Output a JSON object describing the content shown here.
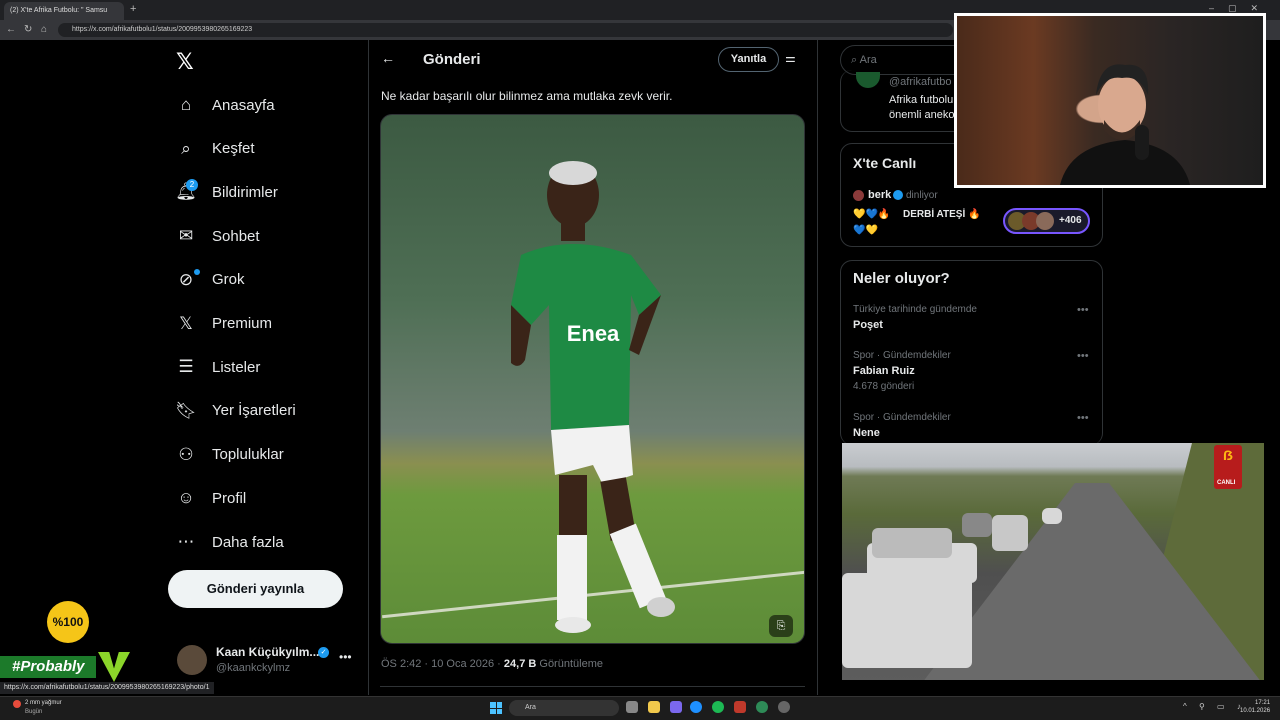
{
  "browser": {
    "tab_title": "(2) X'te Afrika Futbolu: \" Samsu",
    "url": "https://x.com/afrikafutbolu1/status/2009953980265169223",
    "status_url": "https://x.com/afrikafutbolu1/status/2009953980265169223/photo/1"
  },
  "sidebar": {
    "items": [
      {
        "label": "Anasayfa",
        "icon": "home-icon"
      },
      {
        "label": "Keşfet",
        "icon": "search-icon"
      },
      {
        "label": "Bildirimler",
        "icon": "bell-icon"
      },
      {
        "label": "Sohbet",
        "icon": "mail-icon"
      },
      {
        "label": "Grok",
        "icon": "grok-icon"
      },
      {
        "label": "Premium",
        "icon": "x-premium-icon"
      },
      {
        "label": "Listeler",
        "icon": "list-icon"
      },
      {
        "label": "Yer İşaretleri",
        "icon": "bookmark-icon"
      },
      {
        "label": "Topluluklar",
        "icon": "communities-icon"
      },
      {
        "label": "Profil",
        "icon": "profile-icon"
      },
      {
        "label": "Daha fazla",
        "icon": "more-icon"
      }
    ],
    "notification_count": "2",
    "post_button": "Gönderi yayınla",
    "account": {
      "name": "Kaan Küçükyılm...",
      "handle": "@kaankckylmz"
    }
  },
  "main": {
    "title": "Gönderi",
    "reply_button": "Yanıtla",
    "post_text": "Ne kadar başarılı olur bilinmez ama mutlaka zevk verir.",
    "jersey_sponsor": "Enea",
    "meta_time": "ÖS 2:42 · 10 Oca 2026 · ",
    "meta_views": "24,7 B",
    "meta_views_label": " Görüntüleme"
  },
  "right": {
    "search_placeholder": "Ara",
    "card1": {
      "handle": "@afrikafutbo",
      "line1": "Afrika futbolu",
      "line2": "önemli aneko"
    },
    "live": {
      "title": "X'te Canlı",
      "user": "berk",
      "status": "dinliyor",
      "emoji_prefix": "💛💙🔥",
      "space_title": "DERBİ ATEŞİ",
      "emoji_suffix": "🔥",
      "emoji_line2": "💙💛",
      "listener_count": "+406"
    },
    "trends_title": "Neler oluyor?",
    "trends": [
      {
        "context": "Türkiye tarihinde gündemde",
        "name": "Poşet",
        "count": ""
      },
      {
        "context": "Spor · Gündemdekiler",
        "name": "Fabian Ruiz",
        "count": "4.678 gönderi"
      },
      {
        "context": "Spor · Gündemdekiler",
        "name": "Nene",
        "count": ""
      }
    ]
  },
  "overlays": {
    "x100": "%100",
    "probably": "#Probably",
    "gs_live": "CANLI"
  },
  "taskbar": {
    "weather_line1": "2 mm yağmur",
    "weather_line2": "Bugün",
    "search": "Ara",
    "time": "17:21",
    "date": "10.01.2026"
  },
  "colors": {
    "accent": "#1d9bf0",
    "background": "#000000",
    "border": "#2f3336",
    "live_ring": "#7856ff"
  }
}
